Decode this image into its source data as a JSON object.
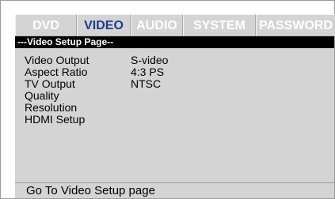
{
  "tabs": [
    {
      "label": "DVD",
      "active": false
    },
    {
      "label": "VIDEO",
      "active": true
    },
    {
      "label": "AUDIO",
      "active": false
    },
    {
      "label": "SYSTEM",
      "active": false
    },
    {
      "label": "PASSWORD",
      "active": false
    }
  ],
  "page": {
    "header": "---Video Setup Page--",
    "settings": [
      {
        "label": "Video Output",
        "value": "S-video"
      },
      {
        "label": "Aspect Ratio",
        "value": "4:3 PS"
      },
      {
        "label": "TV Output",
        "value": "NTSC"
      },
      {
        "label": "Quality",
        "value": ""
      },
      {
        "label": "Resolution",
        "value": ""
      },
      {
        "label": "HDMI Setup",
        "value": ""
      }
    ]
  },
  "status": {
    "text": "Go To Video Setup page"
  },
  "colors": {
    "panel_gray": "#d4d4d4",
    "active_tab_text": "#1b3f8a",
    "inactive_tab_text": "#ffffff",
    "header_bar": "#000000"
  }
}
